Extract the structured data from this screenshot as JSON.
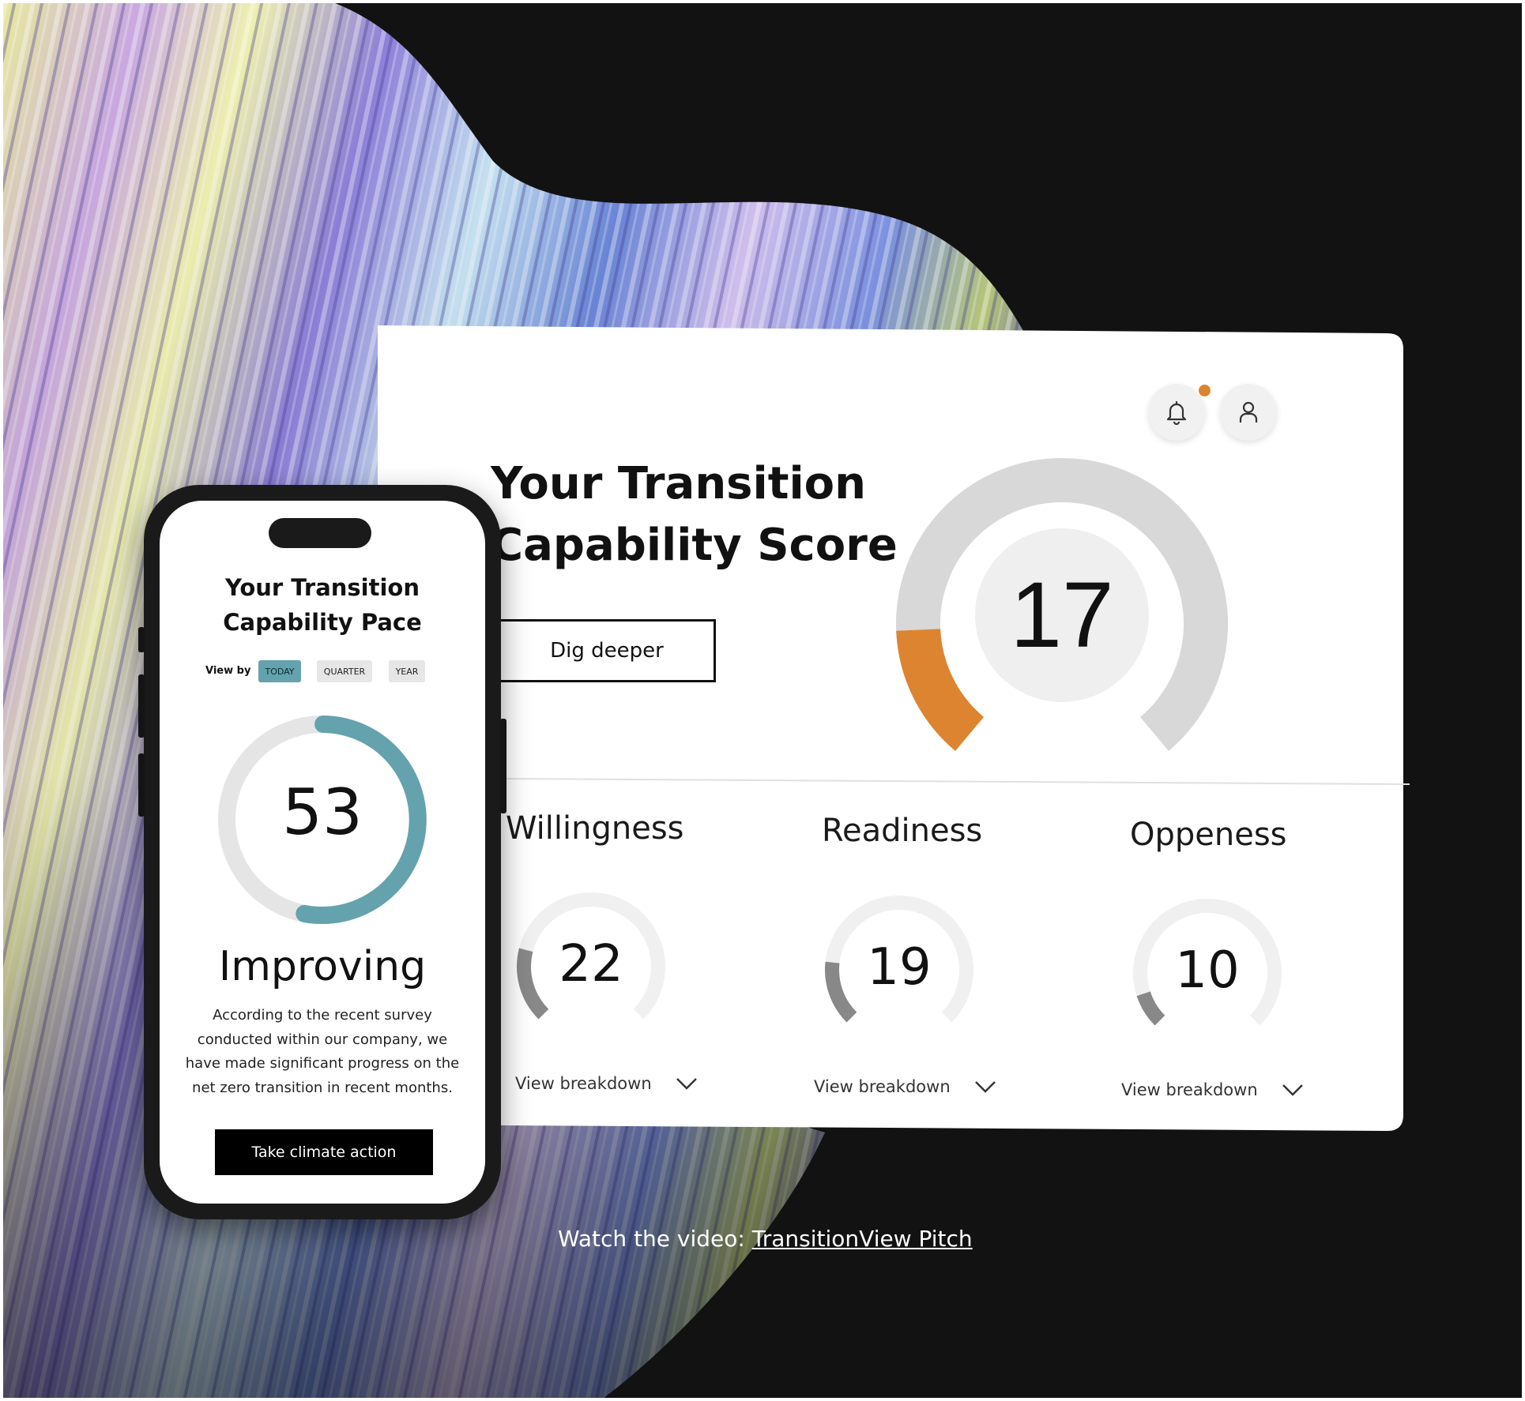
{
  "dashboard": {
    "title_line1": "Your Transition",
    "title_line2": "Capability Score",
    "dig_button": "Dig deeper",
    "score": "17",
    "score_fraction": 0.17,
    "accent_color": "#dd8430",
    "notification_icon": "bell-icon",
    "profile_icon": "user-icon",
    "metrics": [
      {
        "name": "Willingness",
        "value": "22",
        "fraction": 0.22,
        "action": "View breakdown"
      },
      {
        "name": "Readiness",
        "value": "19",
        "fraction": 0.19,
        "action": "View breakdown"
      },
      {
        "name": "Oppeness",
        "value": "10",
        "fraction": 0.1,
        "action": "View breakdown"
      }
    ]
  },
  "phone": {
    "title_line1": "Your Transition",
    "title_line2": "Capability Pace",
    "view_by_label": "View by",
    "periods": [
      "TODAY",
      "QUARTER",
      "YEAR"
    ],
    "selected_period": "TODAY",
    "score": "53",
    "score_fraction": 0.53,
    "ring_color": "#64a2ae",
    "status": "Improving",
    "description": "According to the recent survey conducted within our company, we have made significant progress on the net zero transition in recent months.",
    "cta": "Take climate action"
  },
  "caption": {
    "prefix": "Watch the video: ",
    "link": "TransitionView Pitch"
  }
}
